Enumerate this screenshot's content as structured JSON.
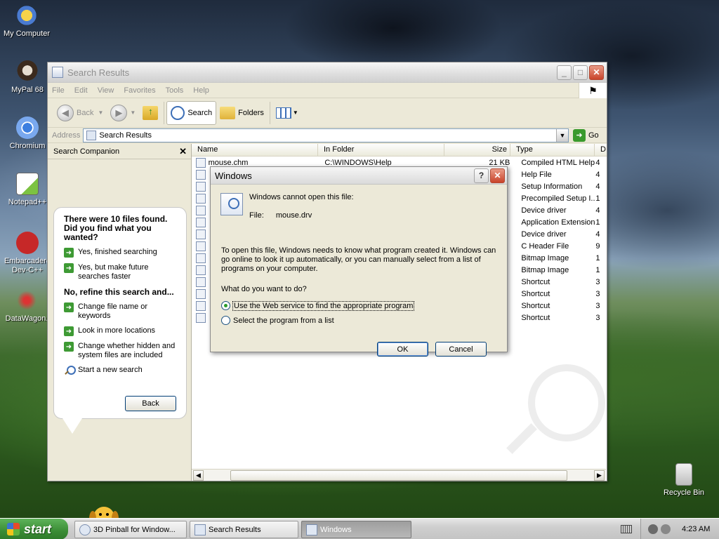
{
  "desktop": {
    "icons": [
      {
        "label": "My Computer"
      },
      {
        "label": "MyPal 68"
      },
      {
        "label": "Chromium"
      },
      {
        "label": "Notepad++"
      },
      {
        "label": "Embarcadero Dev-C++"
      },
      {
        "label": "DataWagon."
      },
      {
        "label": "Recycle Bin"
      }
    ]
  },
  "window": {
    "title": "Search Results",
    "menu": [
      "File",
      "Edit",
      "View",
      "Favorites",
      "Tools",
      "Help"
    ],
    "toolbar": {
      "back": "Back",
      "search": "Search",
      "folders": "Folders"
    },
    "address": {
      "label": "Address",
      "value": "Search Results",
      "go": "Go"
    },
    "companion": {
      "title": "Search Companion",
      "found_heading": "There were 10 files found. Did you find what you wanted?",
      "options": [
        "Yes, finished searching",
        "Yes, but make future searches faster"
      ],
      "refine_heading": "No, refine this search and...",
      "refine_options": [
        "Change file name or keywords",
        "Look in more locations",
        "Change whether hidden and system files are included",
        "Start a new search"
      ],
      "back": "Back"
    },
    "columns": [
      "Name",
      "In Folder",
      "Size",
      "Type",
      "D"
    ],
    "rows": [
      {
        "name": "mouse.chm",
        "folder": "C:\\WINDOWS\\Help",
        "size": "21 KB",
        "type": "Compiled HTML Help...",
        "d": "4"
      },
      {
        "name": "",
        "folder": "",
        "size": "",
        "type": "Help File",
        "d": "4"
      },
      {
        "name": "",
        "folder": "",
        "size": "",
        "type": "Setup Information",
        "d": "4"
      },
      {
        "name": "",
        "folder": "",
        "size": "",
        "type": "Precompiled Setup I...",
        "d": "1"
      },
      {
        "name": "",
        "folder": "",
        "size": "",
        "type": "Device driver",
        "d": "4"
      },
      {
        "name": "",
        "folder": "",
        "size": "",
        "type": "Application Extension",
        "d": "1"
      },
      {
        "name": "",
        "folder": "",
        "size": "",
        "type": "Device driver",
        "d": "4"
      },
      {
        "name": "",
        "folder": "",
        "size": "",
        "type": "C Header File",
        "d": "9"
      },
      {
        "name": "",
        "folder": "",
        "size": "",
        "type": "Bitmap Image",
        "d": "1"
      },
      {
        "name": "",
        "folder": "",
        "size": "",
        "type": "Bitmap Image",
        "d": "1"
      },
      {
        "name": "",
        "folder": "",
        "size": "",
        "type": "Shortcut",
        "d": "3"
      },
      {
        "name": "",
        "folder": "",
        "size": "",
        "type": "Shortcut",
        "d": "3"
      },
      {
        "name": "",
        "folder": "",
        "size": "",
        "type": "Shortcut",
        "d": "3"
      },
      {
        "name": "",
        "folder": "",
        "size": "",
        "type": "Shortcut",
        "d": "3"
      }
    ]
  },
  "dialog": {
    "title": "Windows",
    "message": "Windows cannot open this file:",
    "file_label": "File:",
    "file_name": "mouse.drv",
    "paragraph": "To open this file, Windows needs to know what program created it.  Windows can go online to look it up automatically, or you can manually select from a list of programs on your computer.",
    "question": "What do you want to do?",
    "option_web": "Use the Web service to find the appropriate program",
    "option_list": "Select the program from a list",
    "ok": "OK",
    "cancel": "Cancel"
  },
  "taskbar": {
    "start": "start",
    "items": [
      "3D Pinball for Window...",
      "Search Results",
      "Windows"
    ],
    "clock": "4:23 AM"
  }
}
